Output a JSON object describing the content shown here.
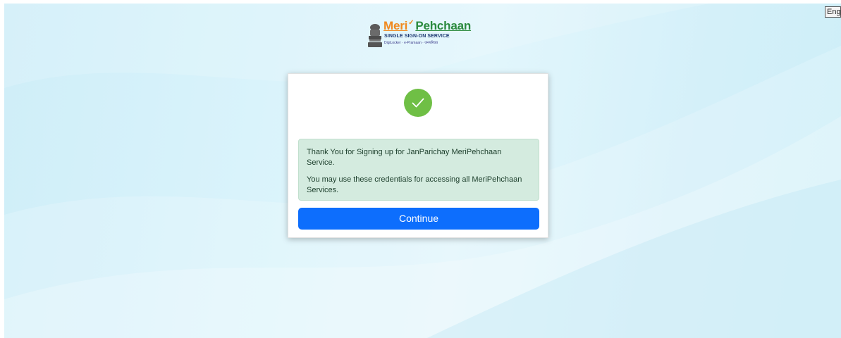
{
  "language_selector": {
    "selected": "English"
  },
  "brand": {
    "name_part1": "Meri",
    "name_part2": "Pehchaan",
    "tagline": "SINGLE SIGN-ON SERVICE",
    "partners": "DigiLocker · e-Pramaan · जनपरिचय",
    "emblem_icon": "national-emblem-icon"
  },
  "card": {
    "status_icon": "check-circle-icon",
    "status_color": "#6fbf45",
    "message_line1": "Thank You for Signing up for JanParichay MeriPehchaan Service.",
    "message_line2": "You may use these credentials for accessing all MeriPehchaan Services.",
    "continue_label": "Continue",
    "button_color": "#0d6efd",
    "alert_bg": "#d4ebdf"
  }
}
